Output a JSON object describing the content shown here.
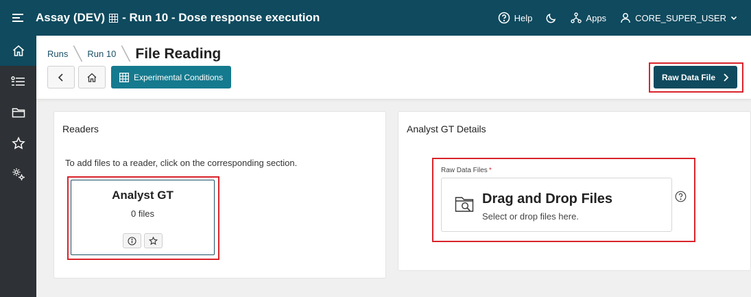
{
  "header": {
    "title": "Assay (DEV)",
    "subtitle": "- Run 10 - Dose response execution",
    "help_label": "Help",
    "apps_label": "Apps",
    "user_label": "CORE_SUPER_USER"
  },
  "sidebar": {
    "items": [
      {
        "icon": "home-icon"
      },
      {
        "icon": "list-icon"
      },
      {
        "icon": "folder-icon"
      },
      {
        "icon": "star-icon"
      },
      {
        "icon": "settings-icon"
      }
    ]
  },
  "breadcrumb": {
    "items": [
      "Runs",
      "Run 10"
    ],
    "current": "File Reading"
  },
  "toolbar": {
    "experimental_conditions_label": "Experimental Conditions",
    "raw_data_file_label": "Raw Data File"
  },
  "readers": {
    "title": "Readers",
    "help_text": "To add files to a reader, click on the corresponding section.",
    "tile": {
      "name": "Analyst GT",
      "count": "0 files"
    }
  },
  "details": {
    "title": "Analyst GT Details",
    "field_label": "Raw Data Files",
    "required_mark": "*",
    "dropzone_title": "Drag and Drop Files",
    "dropzone_subtitle": "Select or drop files here."
  },
  "colors": {
    "header_bg": "#0f4a5e",
    "accent_button": "#157a8e",
    "sidebar_bg": "#2e3135",
    "highlight_border": "#d9232a"
  }
}
